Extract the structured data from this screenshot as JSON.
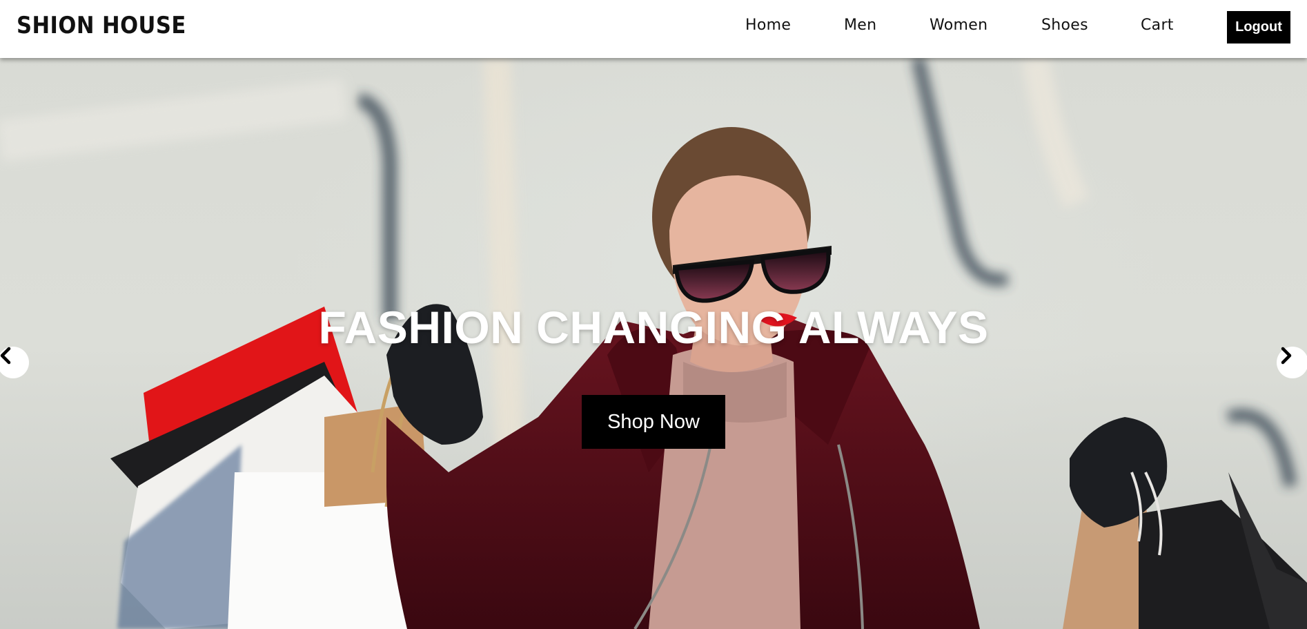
{
  "header": {
    "brand": "SHION HOUSE",
    "nav": [
      {
        "label": "Home"
      },
      {
        "label": "Men"
      },
      {
        "label": "Women"
      },
      {
        "label": "Shoes"
      },
      {
        "label": "Cart"
      }
    ],
    "logout_label": "Logout"
  },
  "hero": {
    "headline": "FASHION CHANGING ALWAYS",
    "cta_label": "Shop Now",
    "prev_icon": "chevron-left-icon",
    "next_icon": "chevron-right-icon"
  },
  "colors": {
    "button_bg": "#000000",
    "button_text": "#ffffff",
    "coat": "#5e0f1b",
    "lips": "#e0141f"
  }
}
